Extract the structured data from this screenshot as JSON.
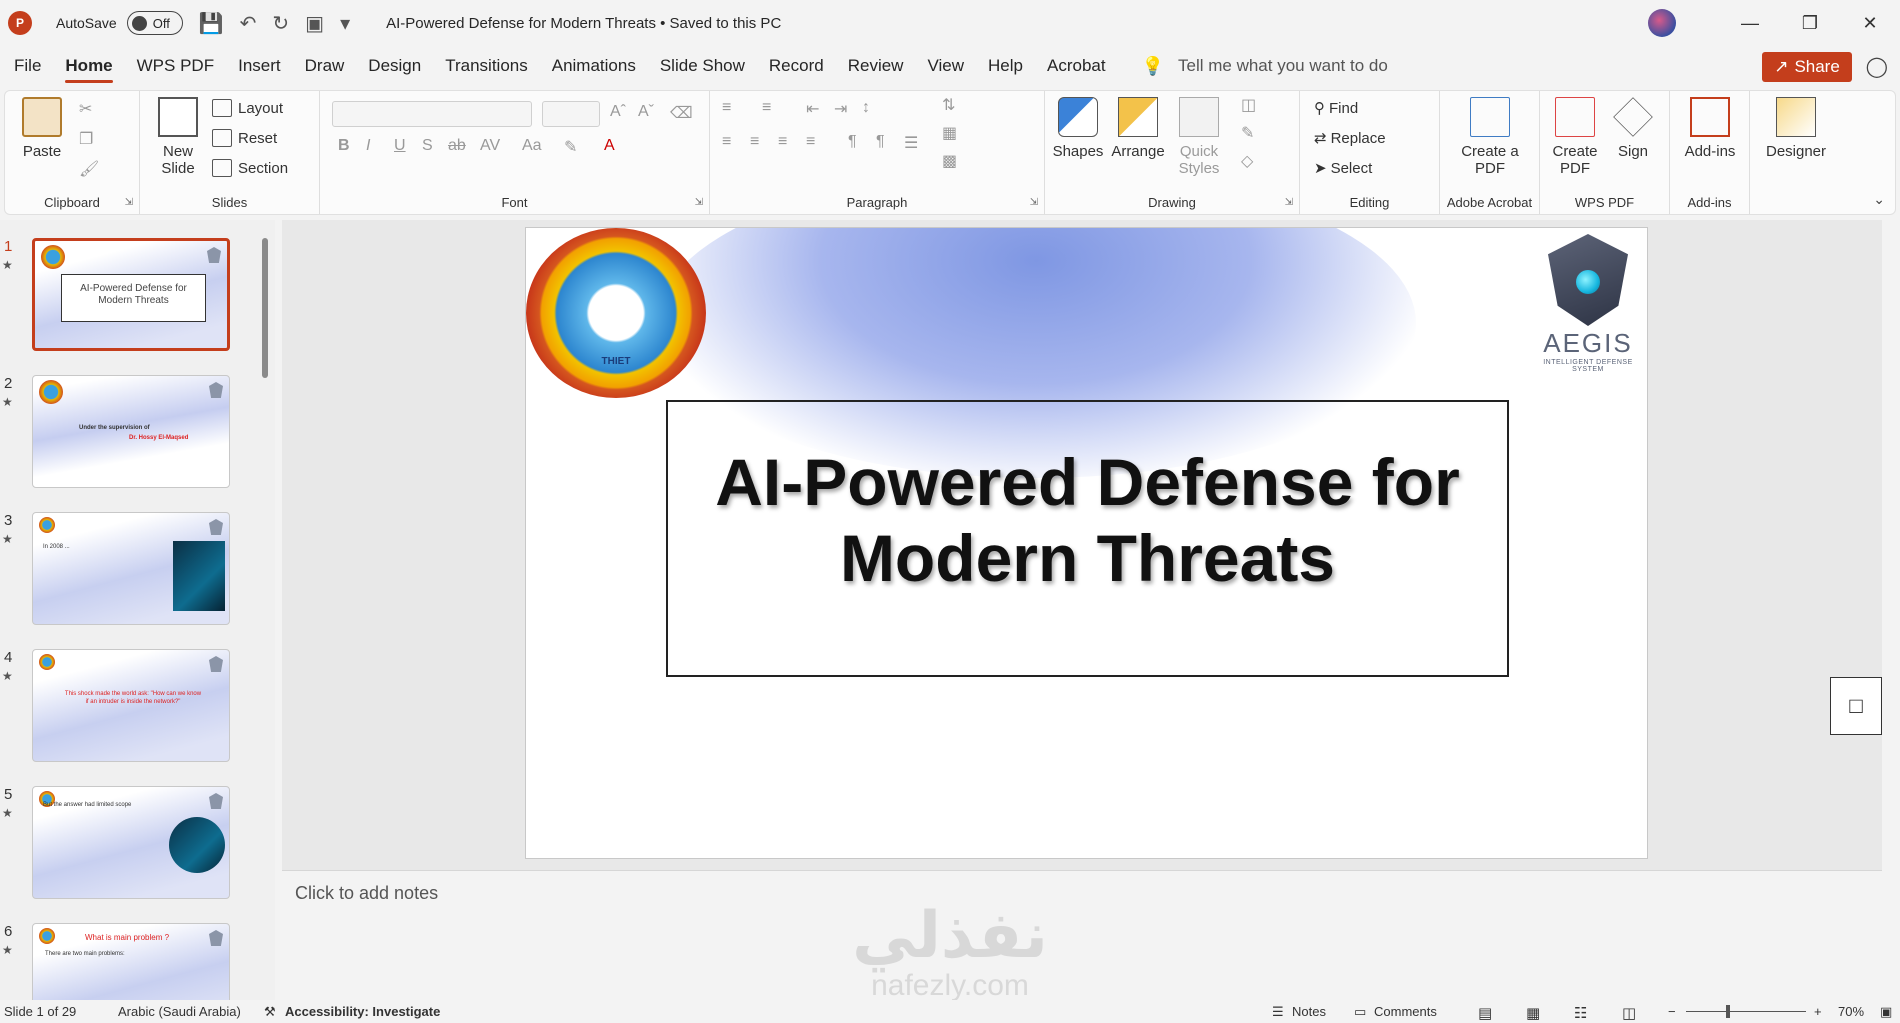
{
  "app": {
    "autosave_label": "AutoSave",
    "autosave_state": "Off",
    "document_title": "AI-Powered Defense for Modern Threats  •  Saved to this PC",
    "logo_letter": "P",
    "accent": "#c43e1c"
  },
  "tabs": [
    "File",
    "Home",
    "WPS PDF",
    "Insert",
    "Draw",
    "Design",
    "Transitions",
    "Animations",
    "Slide Show",
    "Record",
    "Review",
    "View",
    "Help",
    "Acrobat"
  ],
  "tell_me": "Tell me what you want to do",
  "share_label": "Share",
  "ribbon": {
    "clipboard": {
      "paste": "Paste",
      "label": "Clipboard"
    },
    "slides": {
      "new_slide": "New Slide",
      "layout": "Layout",
      "reset": "Reset",
      "section": "Section",
      "label": "Slides"
    },
    "font": {
      "label": "Font"
    },
    "paragraph": {
      "label": "Paragraph"
    },
    "drawing": {
      "shapes": "Shapes",
      "arrange": "Arrange",
      "quick_styles": "Quick Styles",
      "label": "Drawing"
    },
    "editing": {
      "find": "Find",
      "replace": "Replace",
      "select": "Select",
      "label": "Editing"
    },
    "adobe": {
      "create_pdf": "Create a PDF",
      "label": "Adobe Acrobat"
    },
    "wps": {
      "create_pdf": "Create PDF",
      "sign": "Sign",
      "label": "WPS PDF"
    },
    "addins": {
      "addins": "Add-ins",
      "label": "Add-ins"
    },
    "designer": {
      "label": "Designer"
    }
  },
  "thumbnails": [
    {
      "num": "1",
      "title": "AI-Powered Defense for Modern Threats",
      "selected": true
    },
    {
      "num": "2",
      "line1": "Under the supervision of",
      "line2": "Dr. Hossy El-Maqsed"
    },
    {
      "num": "3",
      "text": "In 2008 ..."
    },
    {
      "num": "4",
      "text": "This shock made the world ask: \"How can we know if an intruder is inside the network?\""
    },
    {
      "num": "5",
      "text": "But the answer had limited scope"
    },
    {
      "num": "6",
      "heading": "What is main problem ?",
      "text": "There are two main problems:"
    }
  ],
  "slide": {
    "title_line1": "AI-Powered Defense for",
    "title_line2": "Modern Threats",
    "seal_text": "THIET",
    "logo_name": "AEGIS",
    "logo_sub": "INTELLIGENT DEFENSE SYSTEM"
  },
  "notes_placeholder": "Click to add notes",
  "watermark": {
    "arabic": "نفذلي",
    "latin": "nafezly.com"
  },
  "status": {
    "slide_counter": "Slide 1 of 29",
    "language": "Arabic (Saudi Arabia)",
    "accessibility": "Accessibility: Investigate",
    "notes": "Notes",
    "comments": "Comments",
    "zoom": "70%"
  }
}
